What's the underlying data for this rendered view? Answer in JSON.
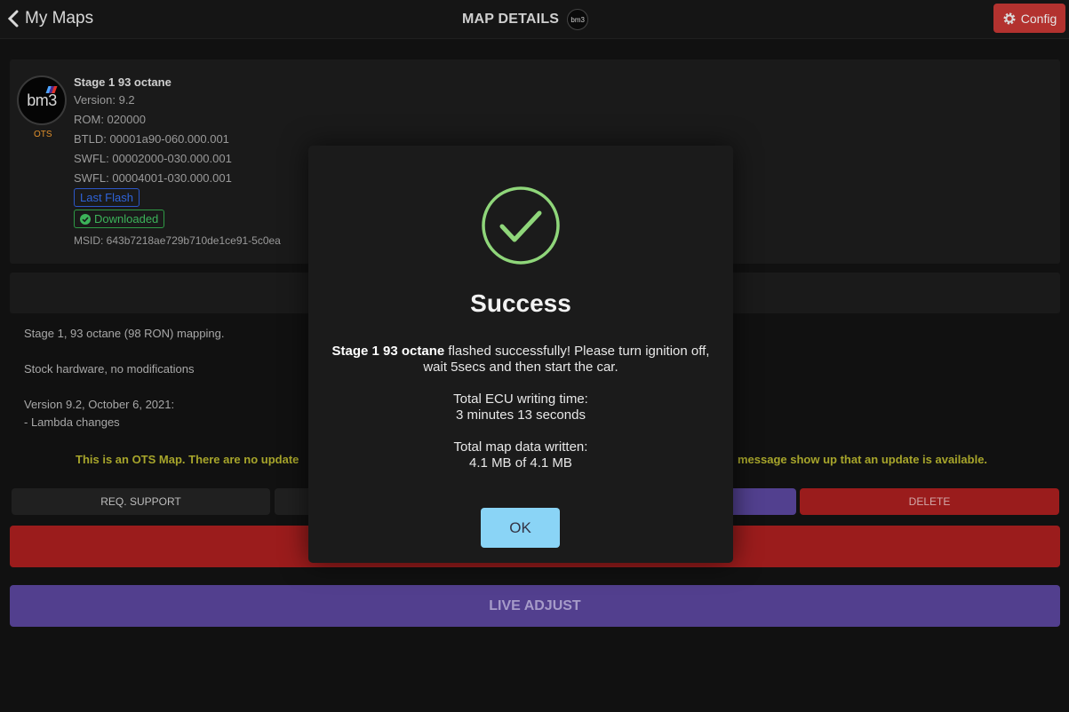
{
  "header": {
    "back_label": "My Maps",
    "title": "MAP DETAILS",
    "mini_logo": "bm3",
    "config_label": "Config"
  },
  "map": {
    "logo_text": "bm3",
    "ots_tag": "OTS",
    "name": "Stage 1 93 octane",
    "version": "Version: 9.2",
    "rom": "ROM: 020000",
    "btld": "BTLD: 00001a90-060.000.001",
    "swfl1": "SWFL: 00002000-030.000.001",
    "swfl2": "SWFL: 00004001-030.000.001",
    "last_flash": "Last Flash",
    "downloaded": "Downloaded",
    "msid": "MSID: 643b7218ae729b710de1ce91-5c0ea"
  },
  "description": {
    "line1": "Stage 1, 93 octane (98 RON) mapping.",
    "line2": "Stock hardware, no modifications",
    "line3": "Version 9.2, October 6, 2021:",
    "line4": "- Lambda changes",
    "notice_left": "This is an OTS Map. There are no update",
    "notice_right": "message show up that an update is available."
  },
  "buttons": {
    "support": "REQ. SUPPORT",
    "delete": "DELETE",
    "live_adjust": "LIVE ADJUST"
  },
  "modal": {
    "title": "Success",
    "map_name": "Stage 1 93 octane",
    "message": " flashed successfully! Please turn ignition off, wait 5secs and then start the car.",
    "time_label": "Total ECU writing time:",
    "time_value": "3 minutes 13 seconds",
    "data_label": "Total map data written:",
    "data_value": "4.1 MB of 4.1 MB",
    "ok_label": "OK"
  },
  "colors": {
    "accent_red": "#b3322f",
    "accent_purple": "#523f8e",
    "success_green": "#8fd67a",
    "ok_button": "#8ad4f6"
  }
}
